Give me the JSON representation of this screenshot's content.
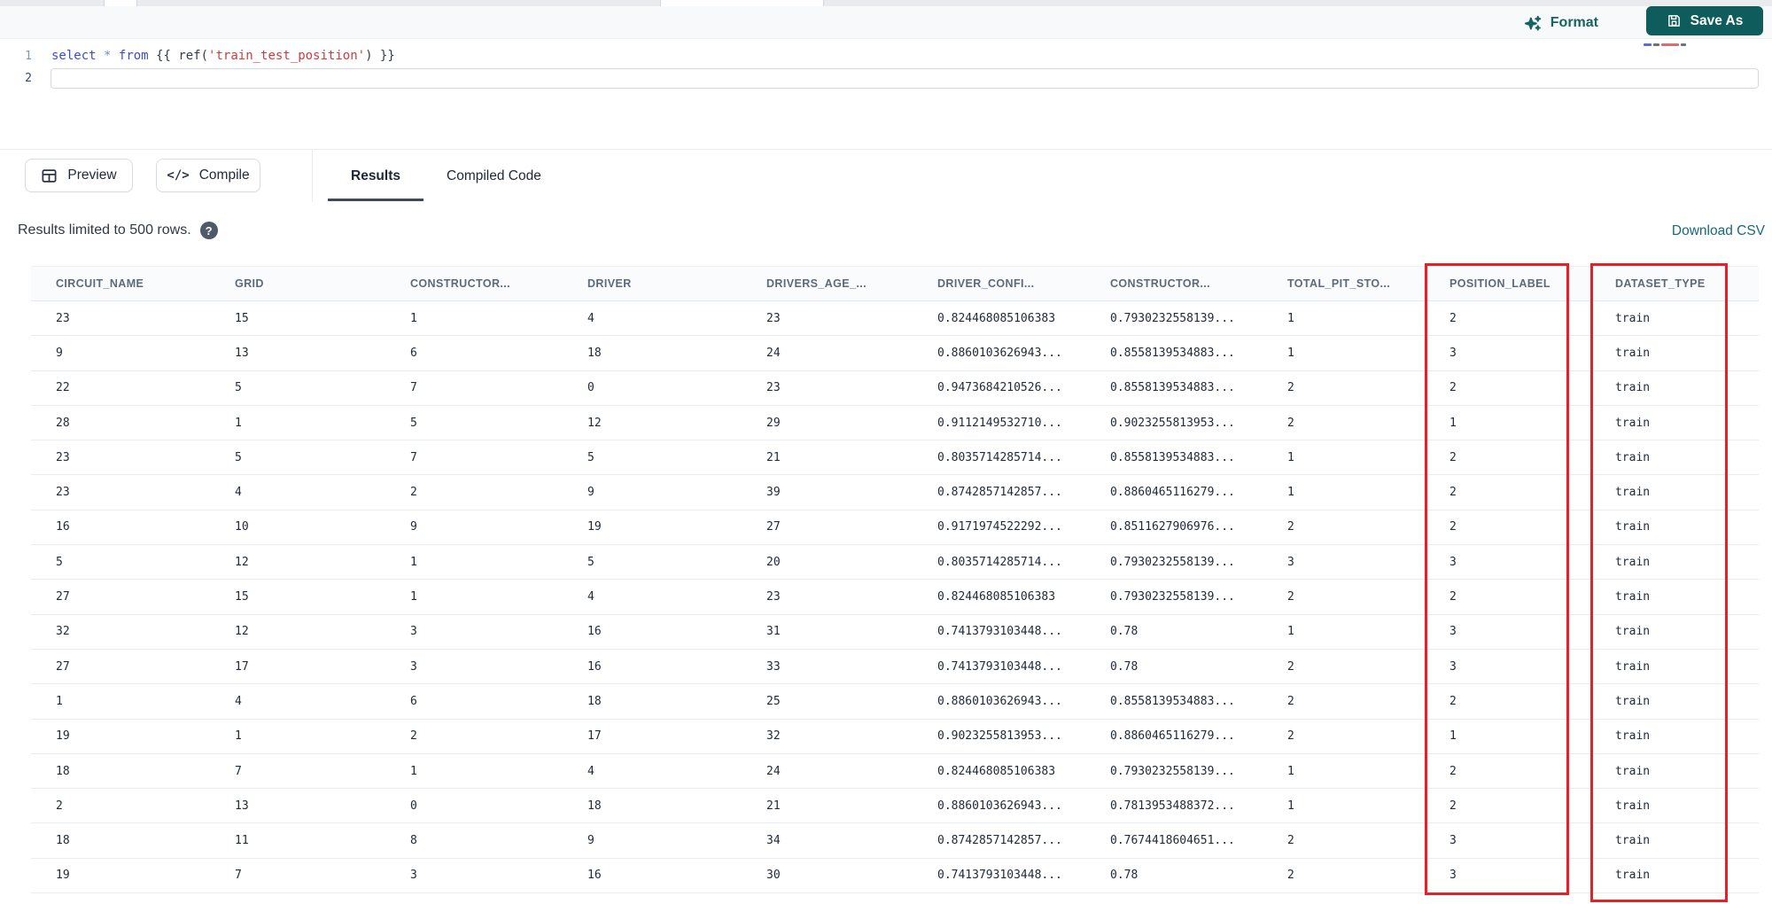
{
  "topbar": {
    "format_label": "Format",
    "save_as_label": "Save As"
  },
  "editor": {
    "line1_number": "1",
    "line2_number": "2",
    "sql_text": "select * from {{ ref('train_test_position') }}",
    "sql_tokens": [
      {
        "text": "select",
        "type": "keyword"
      },
      {
        "text": " ",
        "type": "plain"
      },
      {
        "text": "*",
        "type": "operator"
      },
      {
        "text": " ",
        "type": "plain"
      },
      {
        "text": "from",
        "type": "keyword"
      },
      {
        "text": " {{ ",
        "type": "plain"
      },
      {
        "text": "ref(",
        "type": "plain"
      },
      {
        "text": "'train_test_position'",
        "type": "string"
      },
      {
        "text": ") }}",
        "type": "plain"
      }
    ]
  },
  "action_bar": {
    "preview_label": "Preview",
    "compile_label": "Compile",
    "compile_glyph": "</>",
    "tabs": [
      {
        "label": "Results",
        "active": true
      },
      {
        "label": "Compiled Code",
        "active": false
      }
    ]
  },
  "results_bar": {
    "limit_text": "Results limited to 500 rows.",
    "help_glyph": "?",
    "download_label": "Download CSV"
  },
  "table": {
    "columns": [
      "CIRCUIT_NAME",
      "GRID",
      "CONSTRUCTOR...",
      "DRIVER",
      "DRIVERS_AGE_...",
      "DRIVER_CONFI...",
      "CONSTRUCTOR...",
      "TOTAL_PIT_STO...",
      "POSITION_LABEL",
      "DATASET_TYPE"
    ],
    "rows": [
      [
        "23",
        "15",
        "1",
        "4",
        "23",
        "0.824468085106383",
        "0.7930232558139...",
        "1",
        "2",
        "train"
      ],
      [
        "9",
        "13",
        "6",
        "18",
        "24",
        "0.8860103626943...",
        "0.8558139534883...",
        "1",
        "3",
        "train"
      ],
      [
        "22",
        "5",
        "7",
        "0",
        "23",
        "0.9473684210526...",
        "0.8558139534883...",
        "2",
        "2",
        "train"
      ],
      [
        "28",
        "1",
        "5",
        "12",
        "29",
        "0.9112149532710...",
        "0.9023255813953...",
        "2",
        "1",
        "train"
      ],
      [
        "23",
        "5",
        "7",
        "5",
        "21",
        "0.8035714285714...",
        "0.8558139534883...",
        "1",
        "2",
        "train"
      ],
      [
        "23",
        "4",
        "2",
        "9",
        "39",
        "0.8742857142857...",
        "0.8860465116279...",
        "1",
        "2",
        "train"
      ],
      [
        "16",
        "10",
        "9",
        "19",
        "27",
        "0.9171974522292...",
        "0.8511627906976...",
        "2",
        "2",
        "train"
      ],
      [
        "5",
        "12",
        "1",
        "5",
        "20",
        "0.8035714285714...",
        "0.7930232558139...",
        "3",
        "3",
        "train"
      ],
      [
        "27",
        "15",
        "1",
        "4",
        "23",
        "0.824468085106383",
        "0.7930232558139...",
        "2",
        "2",
        "train"
      ],
      [
        "32",
        "12",
        "3",
        "16",
        "31",
        "0.7413793103448...",
        "0.78",
        "1",
        "3",
        "train"
      ],
      [
        "27",
        "17",
        "3",
        "16",
        "33",
        "0.7413793103448...",
        "0.78",
        "2",
        "3",
        "train"
      ],
      [
        "1",
        "4",
        "6",
        "18",
        "25",
        "0.8860103626943...",
        "0.8558139534883...",
        "2",
        "2",
        "train"
      ],
      [
        "19",
        "1",
        "2",
        "17",
        "32",
        "0.9023255813953...",
        "0.8860465116279...",
        "2",
        "1",
        "train"
      ],
      [
        "18",
        "7",
        "1",
        "4",
        "24",
        "0.824468085106383",
        "0.7930232558139...",
        "1",
        "2",
        "train"
      ],
      [
        "2",
        "13",
        "0",
        "18",
        "21",
        "0.8860103626943...",
        "0.7813953488372...",
        "1",
        "2",
        "train"
      ],
      [
        "18",
        "11",
        "8",
        "9",
        "34",
        "0.8742857142857...",
        "0.7674418604651...",
        "2",
        "3",
        "train"
      ],
      [
        "19",
        "7",
        "3",
        "16",
        "30",
        "0.7413793103448...",
        "0.78",
        "2",
        "3",
        "train"
      ]
    ]
  },
  "annotations": {
    "highlighted_columns": [
      "POSITION_LABEL",
      "DATASET_TYPE"
    ],
    "box_color": "#ee1d23"
  },
  "colors": {
    "accent_teal": "#0e5c5b",
    "link_teal": "#17697a",
    "sql_keyword_blue": "#3a4bd3",
    "sql_string_red": "#d03a3e",
    "header_text": "#5d6a79",
    "cell_text": "#212b38",
    "annotation_red": "#ee1d23"
  }
}
